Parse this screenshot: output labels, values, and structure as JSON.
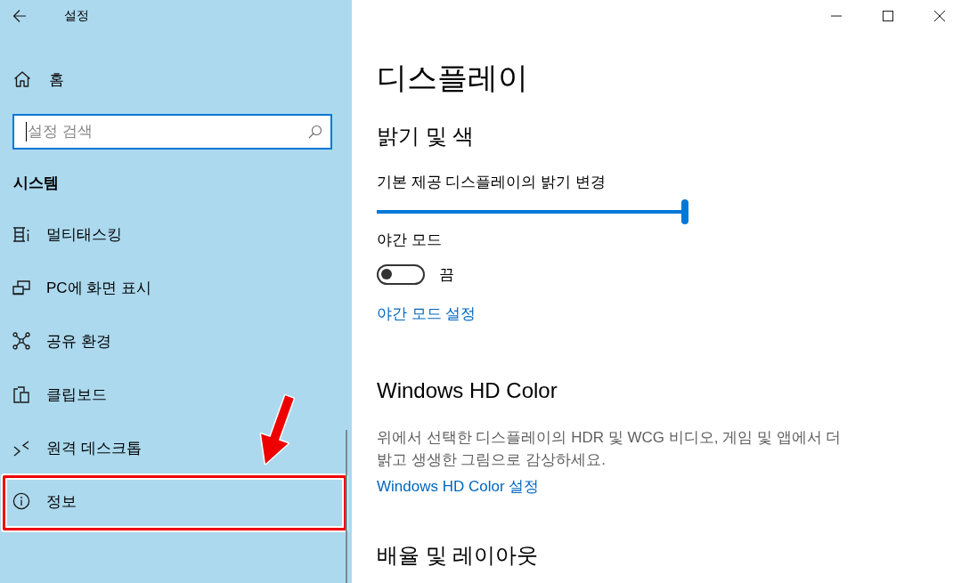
{
  "window": {
    "title": "설정"
  },
  "sidebar": {
    "home": {
      "label": "홈"
    },
    "search": {
      "placeholder": "설정 검색"
    },
    "section_title": "시스템",
    "items": [
      {
        "label": "멀티태스킹",
        "selected": false,
        "highlighted": false
      },
      {
        "label": "PC에 화면 표시",
        "selected": false,
        "highlighted": false
      },
      {
        "label": "공유 환경",
        "selected": false,
        "highlighted": false
      },
      {
        "label": "클립보드",
        "selected": false,
        "highlighted": false
      },
      {
        "label": "원격 데스크톱",
        "selected": false,
        "highlighted": false
      },
      {
        "label": "정보",
        "selected": false,
        "highlighted": true
      }
    ]
  },
  "main": {
    "title": "디스플레이",
    "sections": [
      {
        "heading": "밝기 및 색",
        "brightness": {
          "label": "기본 제공 디스플레이의 밝기 변경",
          "level": 1
        },
        "night_mode": {
          "label": "야간 모드",
          "on": false,
          "state_text": "끔"
        },
        "link": "야간 모드 설정"
      },
      {
        "heading": "Windows HD Color",
        "description": "위에서 선택한 디스플레이의 HDR 및 WCG 비디오, 게임 및 앱에서 더 밝고 생생한 그림으로 감상하세요.",
        "link": "Windows HD Color 설정"
      },
      {
        "heading": "배율 및 레이아웃"
      }
    ]
  }
}
